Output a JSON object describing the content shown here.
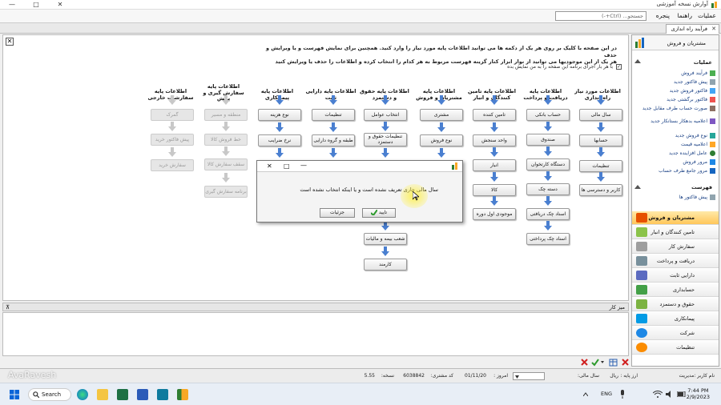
{
  "window": {
    "title": "آوارش نسخه آموزشی",
    "minimize": "—",
    "maximize": "□",
    "close": "✕"
  },
  "menu": {
    "items": [
      "عملیات",
      "راهنما",
      "پنجره"
    ],
    "search_placeholder": "جستجو... (Ctrl+-)"
  },
  "tab": {
    "label": "فرآیند راه اندازی",
    "close": "✕"
  },
  "intro": {
    "line1": "در این صفحه با کلیک بر روی هر یک از دکمه ها می توانید اطلاعات پایه مورد نیاز را وارد کنید. همچنین برای نمایش فهرست و یا ویرایش و حذف",
    "line2": "هر یک از این موجودیها می توانید از نوار ابزار کنار گزینه فهرست مربوط به هر کدام را انتخاب کرده و اطلاعات را حذف یا ویرایش کنید",
    "checkbox": "با هر بار اجرای برنامه این صفحه را به من نمایش بده",
    "check_mark": "✓"
  },
  "columns": [
    {
      "header": "اطلاعات مورد نیاز راه اندازی",
      "buttons": [
        "سال مالی",
        "حسابها",
        "تنظیمات",
        "کاربر و دسترسی ها"
      ]
    },
    {
      "header": "اطلاعات پایه دریافت و پرداخت",
      "buttons": [
        "حساب بانکی",
        "صندوق",
        "دستگاه کارتخوان",
        "دسته چک",
        "اسناد چک دریافتی",
        "اسناد چک پرداختی"
      ]
    },
    {
      "header": "اطلاعات پایه تامین کنندگان و انبار",
      "buttons": [
        "تامین کننده",
        "واحد سنجش",
        "انبار",
        "کالا",
        "موجودی اول دوره"
      ]
    },
    {
      "header": "اطلاعات پایه مشتریان و فروش",
      "buttons": [
        "مشتری",
        "نوع فروش"
      ]
    },
    {
      "header": "اطلاعات پایه حقوق و دستمزد",
      "buttons": [
        "انتخاب عوامل",
        "تنظیمات حقوق و دستمزد",
        "شعب بیمه و مالیات",
        "کارمند"
      ]
    },
    {
      "header": "اطلاعات پایه دارایی ثابت",
      "buttons": [
        "تنظیمات",
        "طبقه و گروه دارایی"
      ]
    },
    {
      "header": "اطلاعات پایه پیمانکاری",
      "buttons": [
        "نوع هزینه",
        "نرخ ضرایب"
      ]
    },
    {
      "header": "اطلاعات پایه سفارش گیری و پخش",
      "buttons": [
        "منطقه و مسیر",
        "خط فروش کالا",
        "سقف سفارش کالا",
        "برنامه سفارش گیری"
      ]
    },
    {
      "header": "اطلاعات پایه سفارشات خارجی",
      "buttons": [
        "گمرک",
        "پیش فاکتور خرید",
        "سفارش خرید"
      ]
    }
  ],
  "dialog": {
    "message": "سال مالی جاری تعریف نشده است و یا اینکه انتخاب نشده است",
    "ok": "تایید",
    "details": "جزئیات",
    "minimize": "—",
    "maximize": "□",
    "close": "✕"
  },
  "workbar": {
    "label": "میز کار",
    "pin": "⊼"
  },
  "side": {
    "header": "مشتریان و فروش",
    "ops_title": "عملیات",
    "ops": [
      "فرآیند فروش",
      "پیش فاکتور جدید",
      "فاکتور فروش جدید",
      "فاکتور برگشتی جدید",
      "صورت حساب طرف مقابل جدید",
      "اعلامیه بدهکار بستانکار جدید",
      "نوع فروش جدید",
      "اعلامیه قیمت",
      "عامل افزاینده جدید",
      "مرور فروش",
      "مرور جامع طرف حساب"
    ],
    "list_title": "فهرست",
    "list": [
      "پیش فاکتور ها"
    ],
    "modules": [
      "مشتریان و فروش",
      "تامین کنندگان و انبار",
      "سفارش کار",
      "دریافت و پرداخت",
      "دارایی ثابت",
      "حسابداری",
      "حقوق و دستمزد",
      "پیمانکاری",
      "شرکت",
      "تنظیمات"
    ]
  },
  "status": {
    "user": "نام کاربر :مدیریت",
    "base_currency": "ارز پایه :",
    "currency_value": "ریال",
    "fiscal_year": "سال مالی:",
    "today": "امروز :",
    "date": "01/11/20",
    "customer_code": "کد مشتری:",
    "customer_value": "6038842",
    "version": "نسخه:",
    "version_value": "5.55"
  },
  "watermark": "AvaRavesh",
  "taskbar": {
    "search": "Search",
    "lang": "ENG",
    "time": "7:44 PM",
    "date": "2/9/2023"
  },
  "colors": {
    "accent": "#ffc65a",
    "title_blue": "#123a80"
  }
}
